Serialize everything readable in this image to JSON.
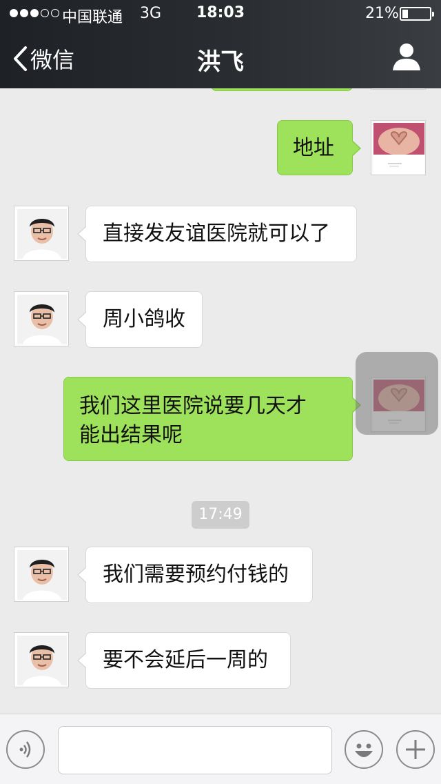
{
  "status_bar": {
    "carrier": "中国联通",
    "network": "3G",
    "time": "18:03",
    "battery_percent": "21%",
    "battery_level": 0.21,
    "signal_bars_filled": 3,
    "signal_bars_total": 5
  },
  "nav": {
    "back_label": "微信",
    "title": "洪飞"
  },
  "messages": [
    {
      "side": "out",
      "text": "地址"
    },
    {
      "side": "in",
      "text": "直接发友谊医院就可以了"
    },
    {
      "side": "in",
      "text": "周小鸽收"
    },
    {
      "side": "out",
      "line1": "我们这里医院说要几天才",
      "line2": "能出结果呢"
    },
    {
      "side": "in",
      "text": "我们需要预约付钱的"
    },
    {
      "side": "in",
      "text": "要不会延后一周的"
    }
  ],
  "timestamp": "17:49",
  "colors": {
    "outgoing_bubble": "#9ee25c",
    "incoming_bubble": "#ffffff",
    "chat_background": "#ebebeb",
    "nav_background": "#2a2d31"
  },
  "icons": {
    "back": "chevron-left-icon",
    "profile": "person-icon",
    "voice": "voice-icon",
    "emoji": "emoji-icon",
    "more": "plus-icon"
  }
}
